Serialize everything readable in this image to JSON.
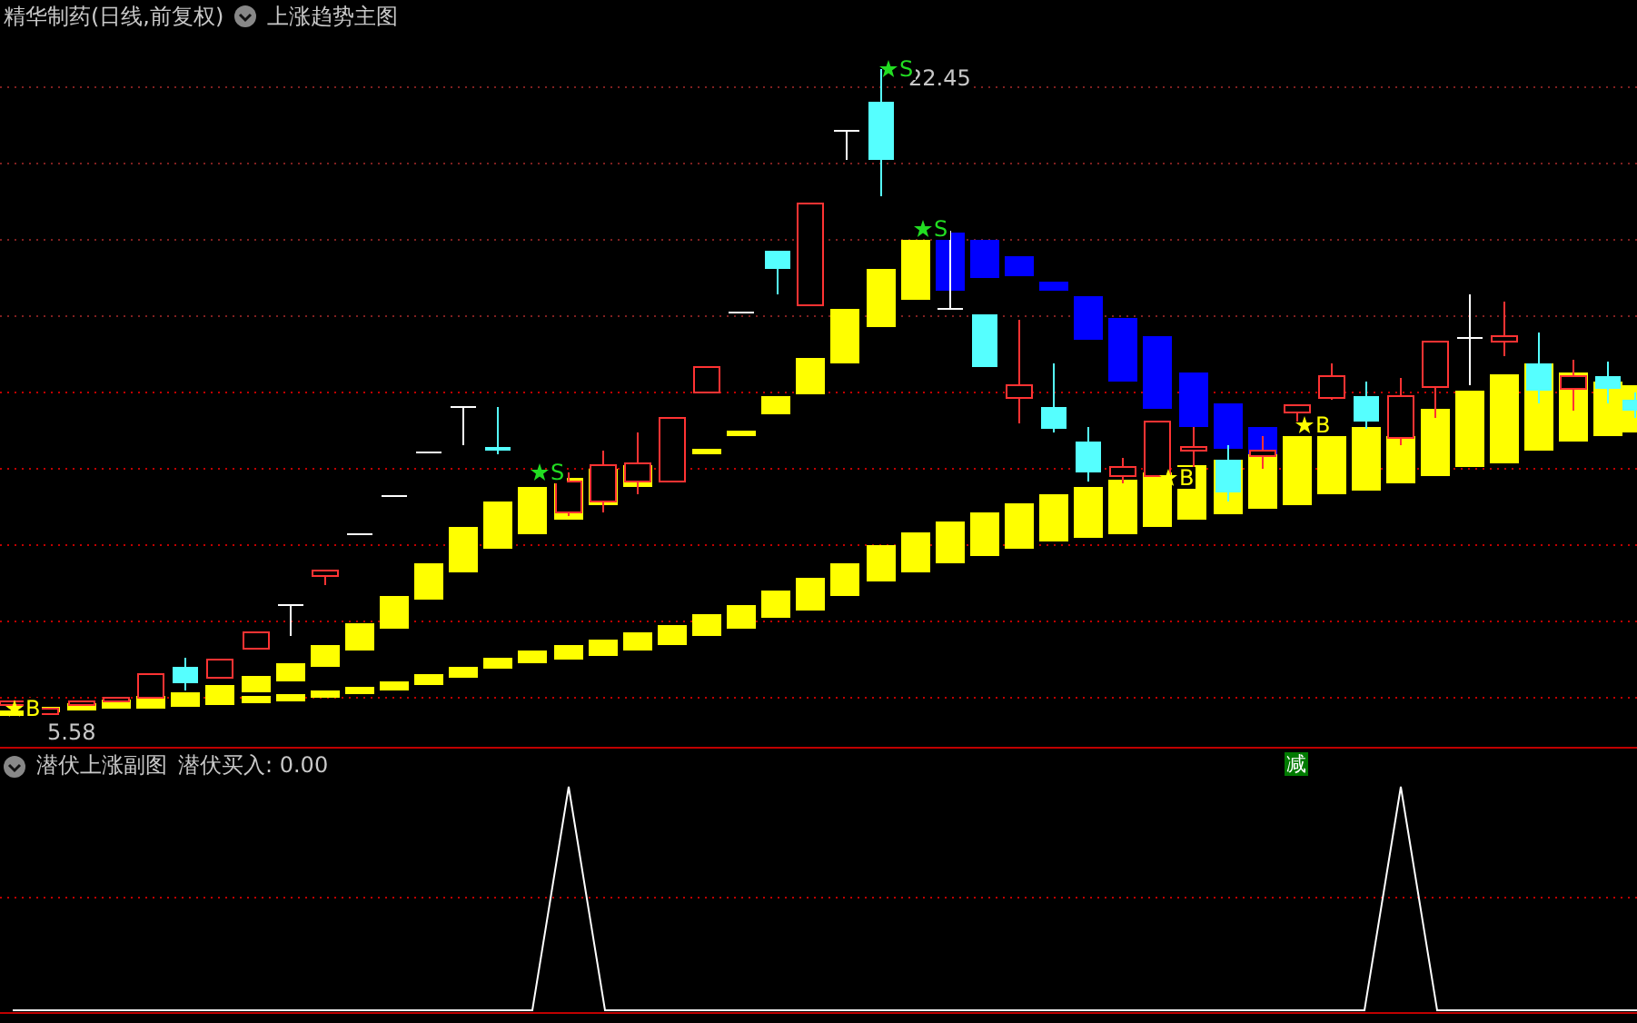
{
  "header": {
    "title": "精华制药(日线,前复权)",
    "indicator": "上涨趋势主图"
  },
  "main_chart": {
    "high_label": "22.45",
    "low_label": "5.58",
    "badge": "减",
    "signals": [
      {
        "kind": "sell",
        "label": "S"
      },
      {
        "kind": "sell",
        "label": "S"
      },
      {
        "kind": "buy",
        "label": "B"
      },
      {
        "kind": "sell",
        "label": "S"
      },
      {
        "kind": "buy",
        "label": "B"
      },
      {
        "kind": "buy",
        "label": "B"
      }
    ]
  },
  "sub_chart": {
    "title": "潜伏上涨副图",
    "reading": "潜伏买入: 0.00"
  }
}
